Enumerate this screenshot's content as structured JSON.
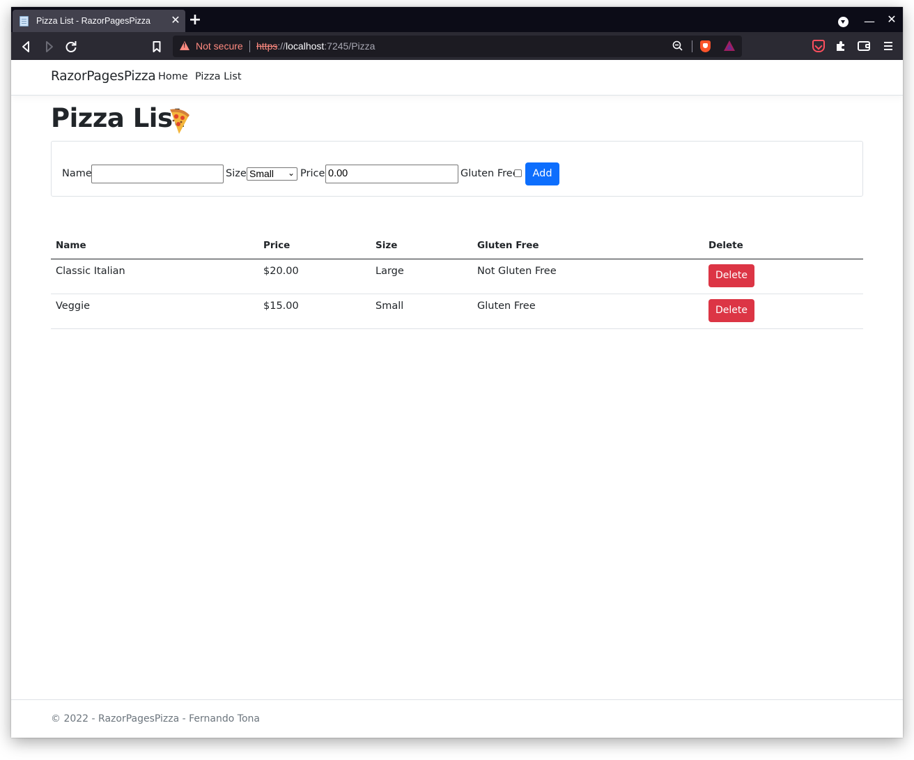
{
  "browser": {
    "tab_title": "Pizza List - RazorPagesPizza",
    "security_label": "Not secure",
    "url_protocol": "https",
    "url_sep": "://",
    "url_host": "localhost",
    "url_rest": ":7245/Pizza"
  },
  "header": {
    "brand": "RazorPagesPizza",
    "nav": [
      "Home",
      "Pizza List"
    ]
  },
  "main": {
    "title": "Pizza List",
    "title_icon": "pizza-slice-icon"
  },
  "form": {
    "name_label": "Name",
    "name_value": "",
    "size_label": "Size",
    "size_selected": "Small",
    "price_label": "Price",
    "price_value": "0.00",
    "gluten_label": "Gluten Free",
    "gluten_checked": false,
    "add_label": "Add"
  },
  "table": {
    "headers": [
      "Name",
      "Price",
      "Size",
      "Gluten Free",
      "Delete"
    ],
    "rows": [
      {
        "name": "Classic Italian",
        "price": "$20.00",
        "size": "Large",
        "gluten": "Not Gluten Free",
        "delete": "Delete"
      },
      {
        "name": "Veggie",
        "price": "$15.00",
        "size": "Small",
        "gluten": "Gluten Free",
        "delete": "Delete"
      }
    ]
  },
  "footer": {
    "text": "© 2022 - RazorPagesPizza - Fernando Tona"
  },
  "colors": {
    "primary": "#0d6efd",
    "danger": "#dc3545",
    "text": "#212529",
    "muted": "#6c757d"
  }
}
